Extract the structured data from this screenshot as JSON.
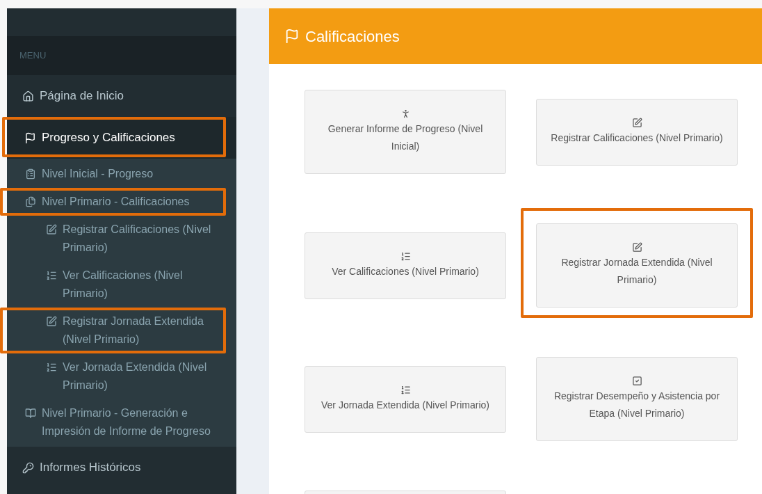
{
  "sidebar": {
    "header": "MENU",
    "items": [
      {
        "label": "Página de Inicio",
        "kind": "home",
        "active": false,
        "highlighted": false
      },
      {
        "label": "Progreso y Calificaciones",
        "kind": "flag",
        "active": true,
        "highlighted": true,
        "children": [
          {
            "label": "Nivel Inicial - Progreso",
            "kind": "form",
            "highlighted": false
          },
          {
            "label": "Nivel Primario - Calificaciones",
            "kind": "files",
            "highlighted": true,
            "children": [
              {
                "label": "Registrar Calificaciones (Nivel Primario)",
                "kind": "edit",
                "highlighted": false
              },
              {
                "label": "Ver Calificaciones (Nivel Primario)",
                "kind": "list",
                "highlighted": false
              },
              {
                "label": "Registrar Jornada Extendida (Nivel Primario)",
                "kind": "edit",
                "highlighted": true
              },
              {
                "label": "Ver Jornada Extendida (Nivel Primario)",
                "kind": "list",
                "highlighted": false
              }
            ]
          },
          {
            "label": "Nivel Primario - Generación e Impresión de Informe de Progreso",
            "kind": "book",
            "highlighted": false
          }
        ]
      },
      {
        "label": "Informes Históricos",
        "kind": "key",
        "active": false,
        "highlighted": false
      }
    ]
  },
  "panel": {
    "title": "Calificaciones",
    "cards": [
      {
        "label": "Generar Informe de Progreso (Nivel Inicial)",
        "kind": "child",
        "highlighted": false
      },
      {
        "label": "Registrar Calificaciones (Nivel Primario)",
        "kind": "edit",
        "highlighted": false
      },
      {
        "label": "Ver Calificaciones (Nivel Primario)",
        "kind": "list",
        "highlighted": false
      },
      {
        "label": "Registrar Jornada Extendida (Nivel Primario)",
        "kind": "edit",
        "highlighted": true
      },
      {
        "label": "Ver Jornada Extendida (Nivel Primario)",
        "kind": "list",
        "highlighted": false
      },
      {
        "label": "Registrar Desempeño y Asistencia por Etapa (Nivel Primario)",
        "kind": "check",
        "highlighted": false
      }
    ]
  }
}
